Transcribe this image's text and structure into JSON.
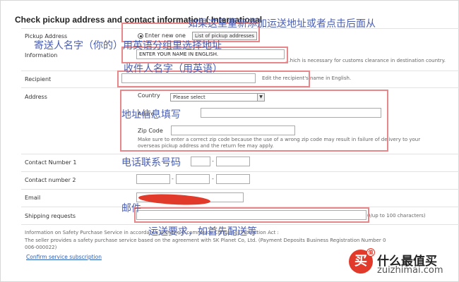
{
  "section_title": "Check pickup address and contact information ( International",
  "pickup": {
    "label": "Pickup Address",
    "radio_label": "Enter new one",
    "list_button": "List of pickup addresses"
  },
  "information": {
    "label": "Information",
    "input_value": "ENTER YOUR NAME IN ENGLISH.",
    "hint": "...hich is necessary for customs clearance in destination country."
  },
  "recipient": {
    "label": "Recipient",
    "hint": "Edit the recipient's name in English."
  },
  "address": {
    "label": "Address",
    "country_label": "Country",
    "country_value": "Please select",
    "address_field_label": "Addre",
    "zip_label": "Zip Code",
    "warning_line1": "Make sure to enter a correct zip code because the use of a wrong zip code may result in failure of delivery to your",
    "warning_line2": "overseas pickup address and the return fee may apply."
  },
  "contact1": {
    "label": "Contact Number 1"
  },
  "contact2": {
    "label": "Contact number 2"
  },
  "email": {
    "label": "Email"
  },
  "shipping": {
    "label": "Shipping requests",
    "counter": "0/up to 100 characters)"
  },
  "footer": {
    "line1": "Information on Safety Purchase Service in accordance with the E-commerce Consumer Protection Act :",
    "line2": "The seller provides a safety purchase service based on the agreement with SK Planet Co, Ltd. (Payment Deposits Business Registration Number 0",
    "line3": "006-000022)",
    "link": "Confirm service subscription"
  },
  "annotations": {
    "a1": "如果这里重新添加运送地址或者点击后面从",
    "a2": "寄送人名字（你的）用英语分组里选择地址",
    "a3": "收件人名字（用英语）",
    "a4": "地址信息填写",
    "a5": "电话联系号码",
    "a6": "邮件",
    "a7": "运送要求，如首先配送等"
  },
  "watermark": {
    "badge": "买",
    "badge_sup": "值",
    "title": "什么最值买",
    "url": "zuizhimai.com"
  },
  "colors": {
    "annotation_box": "#e8878a",
    "annotation_text": "#4a5eb0",
    "link": "#2b5fb8",
    "scribble": "#e23a2a"
  }
}
